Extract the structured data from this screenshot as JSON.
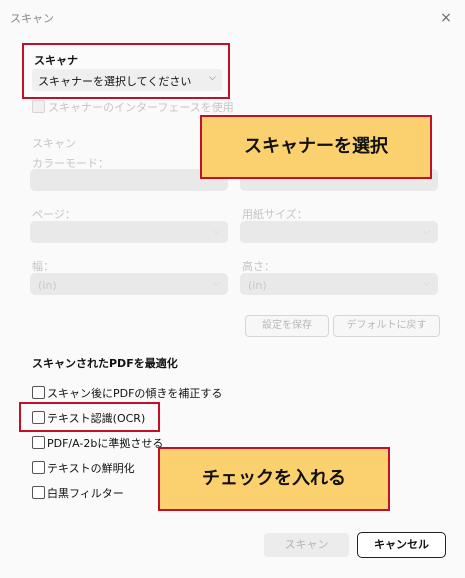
{
  "window": {
    "title": "スキャン",
    "close_glyph": "×"
  },
  "scanner": {
    "label": "スキャナ",
    "selected": "スキャナーを選択してください",
    "chevron": "⌵"
  },
  "use_interface": {
    "label": "スキャナーのインターフェースを使用"
  },
  "scan_section": {
    "heading": "スキャン",
    "color_mode_label": "カラーモード：",
    "page_label": "ページ：",
    "paper_size_label": "用紙サイズ：",
    "width_label": "幅：",
    "width_placeholder": "(in)",
    "height_label": "高さ：",
    "height_placeholder": "(in)",
    "save_settings": "設定を保存",
    "restore_default": "デフォルトに戻す"
  },
  "callouts": {
    "select_scanner": "スキャナーを選択",
    "check_it": "チェックを入れる"
  },
  "optimize": {
    "heading": "スキャンされたPDFを最適化",
    "options": [
      "スキャン後にPDFの傾きを補正する",
      "テキスト認識(OCR)",
      "PDF/A-2bに準拠させる",
      "テキストの鮮明化",
      "白黒フィルター"
    ]
  },
  "footer": {
    "scan_button": "スキャン",
    "cancel_button": "キャンセル"
  },
  "colors": {
    "highlight_border": "#c0102a",
    "callout_fill": "#fbd06e"
  }
}
